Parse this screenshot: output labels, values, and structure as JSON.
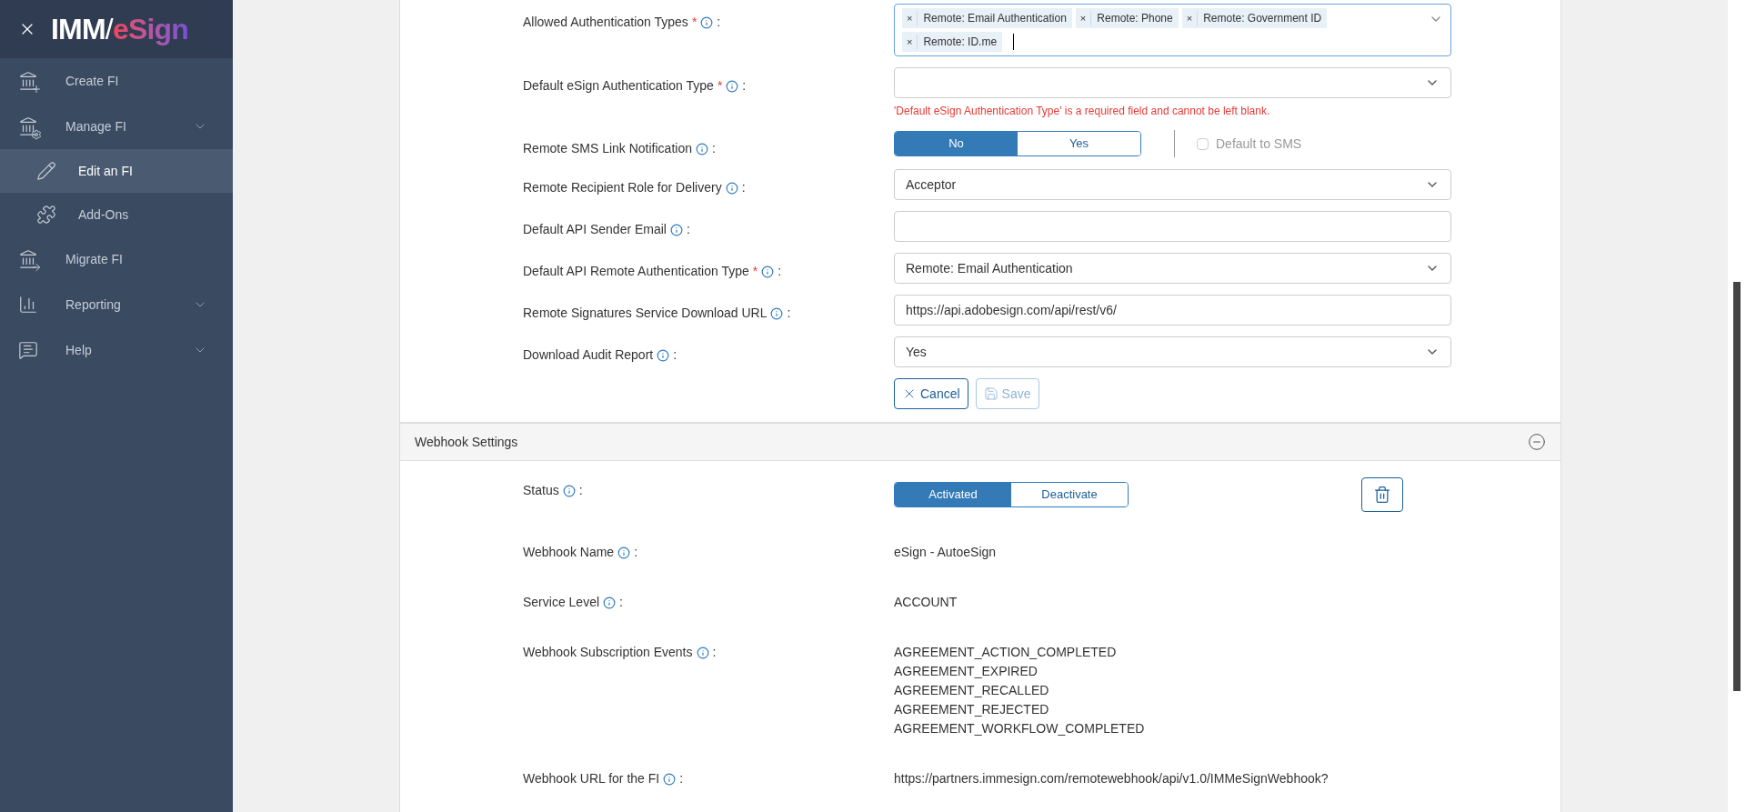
{
  "sidebar": {
    "logo": {
      "left": "IMM",
      "separator": "/",
      "right": "eSign"
    },
    "items": [
      {
        "kind": "link",
        "label": "Create FI",
        "selected": false
      },
      {
        "kind": "group",
        "label": "Manage FI",
        "selected": false,
        "expanded": true,
        "children": [
          {
            "label": "Edit an FI",
            "selected": true
          },
          {
            "label": "Add-Ons",
            "selected": false
          }
        ]
      },
      {
        "kind": "link",
        "label": "Migrate FI",
        "selected": false
      },
      {
        "kind": "group",
        "label": "Reporting",
        "selected": false
      },
      {
        "kind": "group",
        "label": "Help",
        "selected": false
      }
    ]
  },
  "form": {
    "fields": [
      {
        "kind": "tags",
        "label": "Allowed Authentication Types",
        "required_mark": "*",
        "colon": ":",
        "tags": [
          {
            "remove": "×",
            "label": "Remote: Email Authentication"
          },
          {
            "remove": "×",
            "label": "Remote: Phone"
          },
          {
            "remove": "×",
            "label": "Remote: Government ID"
          },
          {
            "remove": "×",
            "label": "Remote: ID.me"
          }
        ]
      },
      {
        "kind": "select",
        "label": "Default eSign Authentication Type",
        "required_mark": "*",
        "colon": ":",
        "error": "'Default eSign Authentication Type' is a required field and cannot be left blank."
      },
      {
        "kind": "toggle",
        "label": "Remote SMS Link Notification",
        "colon": ":",
        "options": [
          {
            "label": "No",
            "selected": true
          },
          {
            "label": "Yes",
            "selected": false
          }
        ],
        "checkbox": {
          "label": "Default to SMS",
          "checked": false,
          "disabled": true
        }
      },
      {
        "kind": "select",
        "label": "Remote Recipient Role for Delivery",
        "colon": ":",
        "value": "Acceptor"
      },
      {
        "kind": "input",
        "label": "Default API Sender Email",
        "colon": ":"
      },
      {
        "kind": "select",
        "label": "Default API Remote Authentication Type",
        "required_mark": "*",
        "colon": ":",
        "value": "Remote: Email Authentication"
      },
      {
        "kind": "input",
        "label": "Remote Signatures Service Download URL",
        "colon": ":",
        "value": "https://api.adobesign.com/api/rest/v6/"
      },
      {
        "kind": "select",
        "label": "Download Audit Report",
        "colon": ":",
        "value": "Yes"
      }
    ],
    "buttons": [
      {
        "label": "Cancel",
        "kind": "cancel",
        "disabled": false
      },
      {
        "label": "Save",
        "kind": "save",
        "disabled": true
      }
    ]
  },
  "webhook": {
    "title": "Webhook Settings",
    "expanded": true,
    "rows": [
      {
        "kind": "toggle",
        "label": "Status",
        "colon": ":",
        "options": [
          {
            "label": "Activated",
            "selected": true
          },
          {
            "label": "Deactivate",
            "selected": false
          }
        ]
      },
      {
        "kind": "text",
        "label": "Webhook Name",
        "colon": ":",
        "lines": [
          "eSign - AutoeSign"
        ]
      },
      {
        "kind": "text",
        "label": "Service Level",
        "colon": ":",
        "lines": [
          "ACCOUNT"
        ]
      },
      {
        "kind": "text",
        "label": "Webhook Subscription Events",
        "colon": ":",
        "lines": [
          "AGREEMENT_ACTION_COMPLETED",
          "AGREEMENT_EXPIRED",
          "AGREEMENT_RECALLED",
          "AGREEMENT_REJECTED",
          "AGREEMENT_WORKFLOW_COMPLETED"
        ]
      },
      {
        "kind": "text",
        "label": "Webhook URL for the FI",
        "colon": ":",
        "lines": [
          "https://partners.immesign.com/remotewebhook/api/v1.0/IMMeSignWebhook?"
        ]
      }
    ]
  }
}
